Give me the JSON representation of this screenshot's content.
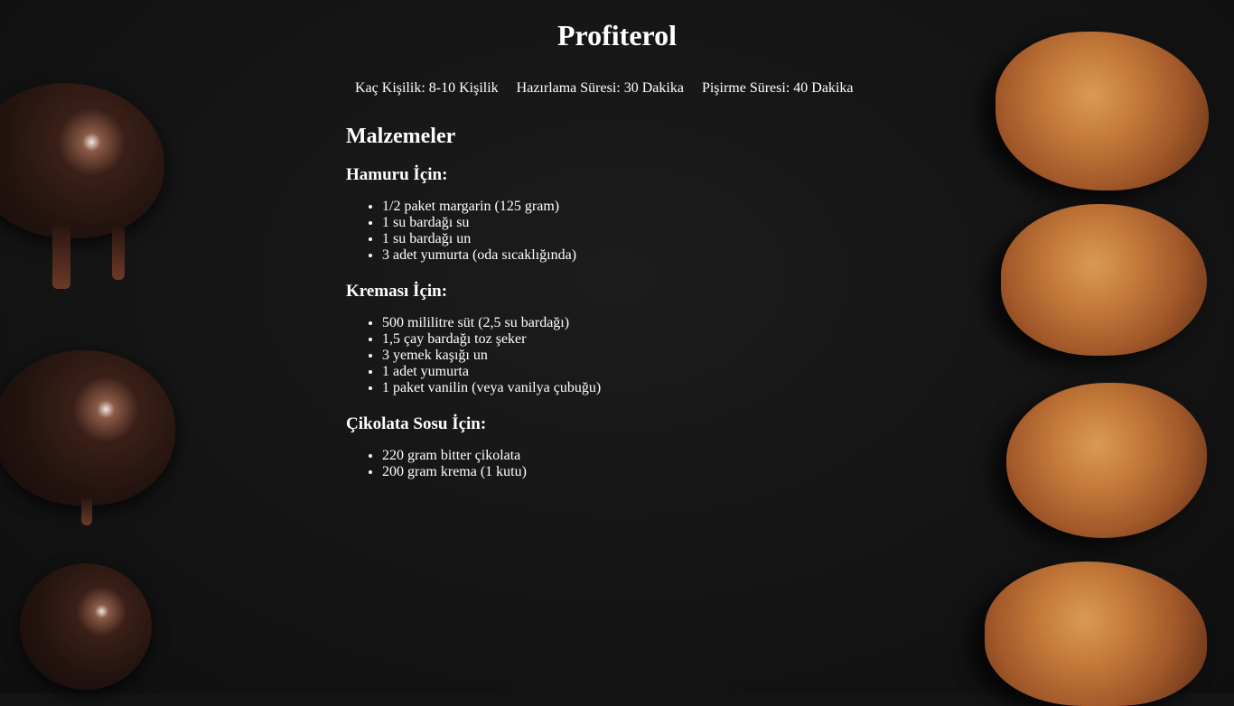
{
  "title": "Profiterol",
  "info": {
    "servings": "Kaç Kişilik: 8-10 Kişilik",
    "prep_time": "Hazırlama Süresi: 30 Dakika",
    "cook_time": "Pişirme Süresi: 40 Dakika"
  },
  "ingredients": {
    "heading": "Malzemeler",
    "dough": {
      "heading": "Hamuru İçin:",
      "items": [
        "1/2 paket margarin (125 gram)",
        "1 su bardağı su",
        "1 su bardağı un",
        "3 adet yumurta (oda sıcaklığında)"
      ]
    },
    "cream": {
      "heading": "Kreması İçin:",
      "items": [
        "500 mililitre süt (2,5 su bardağı)",
        "1,5 çay bardağı toz şeker",
        "3 yemek kaşığı un",
        "1 adet yumurta",
        "1 paket vanilin (veya vanilya çubuğu)"
      ]
    },
    "sauce": {
      "heading": "Çikolata Sosu İçin:",
      "items": [
        "220 gram bitter çikolata",
        "200 gram krema (1 kutu)"
      ]
    }
  }
}
